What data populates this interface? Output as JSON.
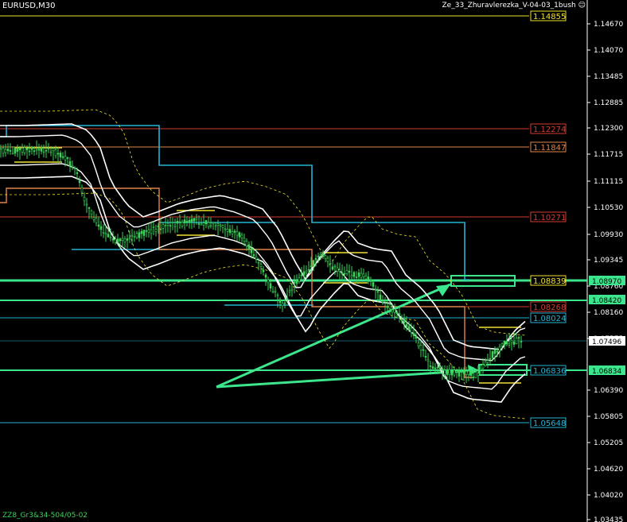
{
  "header": {
    "symbol": "EURUSD,M30",
    "indicator": "Ze_33_Zhuravlerezka_V-04-03_1bush",
    "smiley_icon": "smiley-icon"
  },
  "footer": {
    "text": "ZZ8_Gr3&34-504/05-02"
  },
  "colors": {
    "background": "#000000",
    "bull": "#3cd25a",
    "envelope": "#ffffff",
    "cyan": "#24b4d4",
    "orange": "#e0844c",
    "red": "#d23c32",
    "yellow": "#f0e12d",
    "green": "#3ce68c"
  },
  "price_axis": {
    "ticks": [
      "1.14670",
      "1.14070",
      "1.13485",
      "1.12885",
      "1.12300",
      "1.11715",
      "1.11115",
      "1.10530",
      "1.09930",
      "1.09345",
      "1.08760",
      "1.08160",
      "1.07575",
      "1.06390",
      "1.05805",
      "1.05205",
      "1.04620",
      "1.04020",
      "1.03435"
    ],
    "highlight_labels": [
      {
        "text": "1.08970",
        "color": "#3ce68c"
      },
      {
        "text": "1.08420",
        "color": "#3ce68c"
      },
      {
        "text": "1.07496",
        "color": "#ffffff"
      },
      {
        "text": "1.06834",
        "color": "#3ce68c"
      }
    ]
  },
  "levels": [
    {
      "label": "1.14855",
      "color": "#f0e12d"
    },
    {
      "label": "1.12274",
      "color": "#d23c32"
    },
    {
      "label": "1.11847",
      "color": "#e0844c"
    },
    {
      "label": "1.10271",
      "color": "#d23c32"
    },
    {
      "label": "1.08839",
      "color": "#f0e12d"
    },
    {
      "label": "1.08268",
      "color": "#d23c32"
    },
    {
      "label": "1.08024",
      "color": "#24b4d4"
    },
    {
      "label": "1.06836",
      "color": "#24b4d4"
    },
    {
      "label": "1.05648",
      "color": "#24b4d4"
    }
  ]
}
